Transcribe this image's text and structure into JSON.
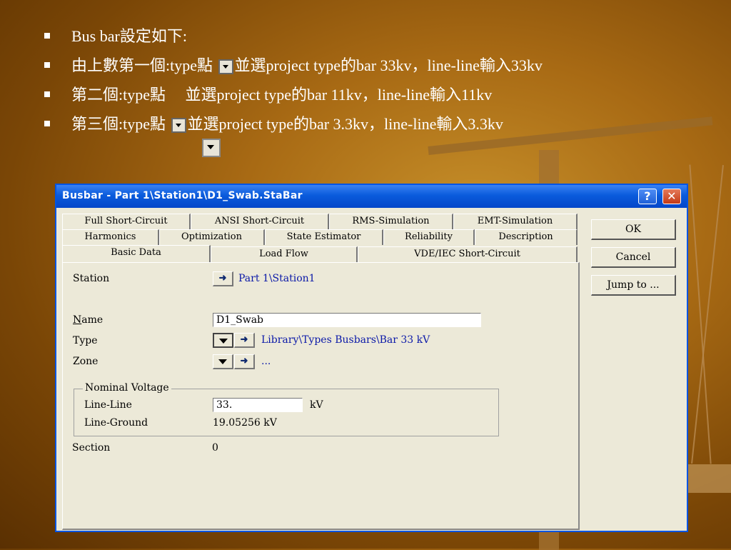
{
  "slide": {
    "bullets": [
      {
        "text": "Bus bar設定如下:"
      },
      {
        "before": "由上數第一個:type點 ",
        "after": "並選project type的bar 33kv，line-line輸入33kv"
      },
      {
        "before": "第二個:type點　 ",
        "after": "並選project type的bar 11kv，line-line輸入11kv"
      },
      {
        "before": "第三個:type點 ",
        "after": "並選project type的bar 3.3kv，line-line輸入3.3kv"
      }
    ]
  },
  "dialog": {
    "title": "Busbar - Part 1\\Station1\\D1_Swab.StaBar",
    "help_label": "?",
    "close_label": "✕",
    "tabs_row1": [
      "Full Short-Circuit",
      "ANSI Short-Circuit",
      "RMS-Simulation",
      "EMT-Simulation"
    ],
    "tabs_row2": [
      "Harmonics",
      "Optimization",
      "State Estimator",
      "Reliability",
      "Description"
    ],
    "tabs_row3": [
      "Basic Data",
      "Load Flow",
      "VDE/IEC Short-Circuit"
    ],
    "station": {
      "label": "Station",
      "arrow": "➜",
      "value": "Part 1\\Station1"
    },
    "name": {
      "label_first": "N",
      "label_rest": "ame",
      "value": "D1_Swab"
    },
    "type": {
      "label": "Type",
      "arrow": "➜",
      "value": "Library\\Types Busbars\\Bar 33 kV"
    },
    "zone": {
      "label": "Zone",
      "arrow": "➜",
      "value": "..."
    },
    "nominal_voltage": {
      "title": "Nominal Voltage",
      "line_line_label": "Line-Line",
      "line_line_value": "33.",
      "line_line_unit": "kV",
      "line_ground_label": "Line-Ground",
      "line_ground_value": "19.05256 kV"
    },
    "section": {
      "label": "Section",
      "value": "0"
    },
    "buttons": {
      "ok": "OK",
      "cancel": "Cancel",
      "jump_first": "J",
      "jump_rest": "ump to ..."
    }
  }
}
